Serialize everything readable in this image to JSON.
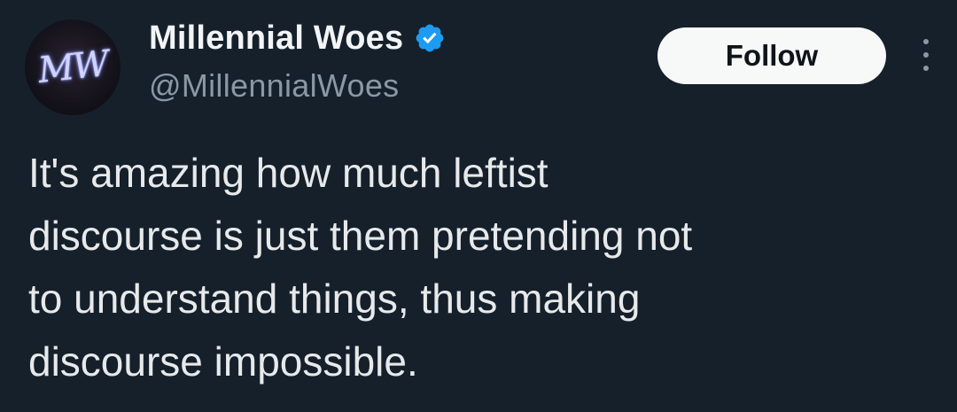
{
  "author": {
    "display_name": "Millennial Woes",
    "handle": "@MillennialWoes",
    "avatar_monogram": "MW",
    "verified": true,
    "verified_color": "#1d9bf0"
  },
  "actions": {
    "follow_label": "Follow",
    "more_icon": "more-vertical-icon"
  },
  "tweet": {
    "text": "It's amazing how much leftist\ndiscourse is just them pretending not\nto understand things, thus making\ndiscourse impossible."
  },
  "colors": {
    "background": "#15202b",
    "text": "#e7e9ea",
    "secondary_text": "#8b98a5",
    "button_bg": "#f7f9f9"
  }
}
